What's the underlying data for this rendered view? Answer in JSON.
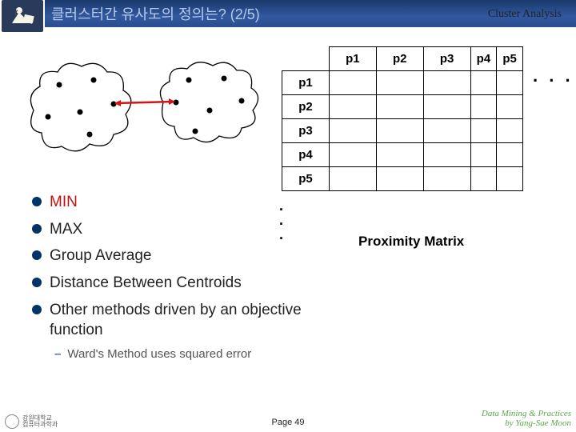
{
  "header": {
    "title": "클러스터간 유사도의 정의는? (2/5)",
    "right_label": "Cluster Analysis"
  },
  "matrix": {
    "col_headers": [
      "p1",
      "p2",
      "p3",
      "p4",
      "p5"
    ],
    "row_headers": [
      "p1",
      "p2",
      "p3",
      "p4",
      "p5"
    ],
    "label": "Proximity Matrix",
    "ellipsis_h": ". . .",
    "ellipsis_v1": ".",
    "ellipsis_v2": ".",
    "ellipsis_v3": "."
  },
  "bullets": {
    "items": [
      {
        "label": "MIN",
        "active": true
      },
      {
        "label": "MAX",
        "active": false
      },
      {
        "label": "Group Average",
        "active": false
      },
      {
        "label": "Distance Between Centroids",
        "active": false
      },
      {
        "label": "Other methods driven by an objective function",
        "active": false
      }
    ],
    "sub": {
      "dash": "–",
      "label": "Ward's Method uses squared error"
    }
  },
  "footer": {
    "logo_line1": "강원대학교",
    "logo_line2": "컴퓨터과학과",
    "page": "Page 49",
    "credit_line1": "Data Mining & Practices",
    "credit_line2": "by Yang-Sae Moon"
  }
}
